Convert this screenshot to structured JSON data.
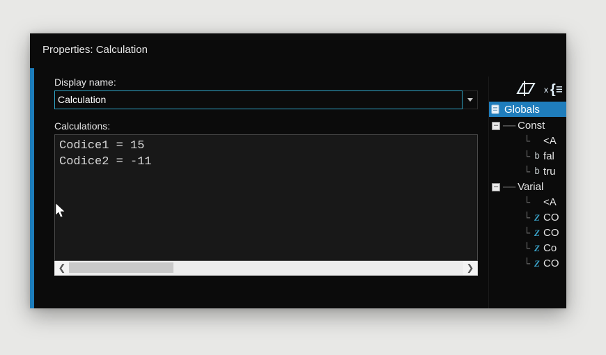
{
  "panel": {
    "title": "Properties: Calculation"
  },
  "display_name": {
    "label": "Display name:",
    "value": "Calculation"
  },
  "calculations": {
    "label": "Calculations:",
    "text": "Codice1 = 15\nCodice2 = -11"
  },
  "sidebar": {
    "globals_header": "Globals",
    "groups": [
      {
        "label": "Const",
        "expanded": true,
        "children": [
          {
            "icon": "",
            "label": "<A"
          },
          {
            "icon": "b",
            "label": "fal"
          },
          {
            "icon": "b",
            "label": "tru"
          }
        ]
      },
      {
        "label": "Varial",
        "expanded": true,
        "children": [
          {
            "icon": "",
            "label": "<A"
          },
          {
            "icon": "Z",
            "label": "CO"
          },
          {
            "icon": "Z",
            "label": "CO"
          },
          {
            "icon": "Z",
            "label": "Co"
          },
          {
            "icon": "Z",
            "label": "CO"
          }
        ]
      }
    ]
  }
}
